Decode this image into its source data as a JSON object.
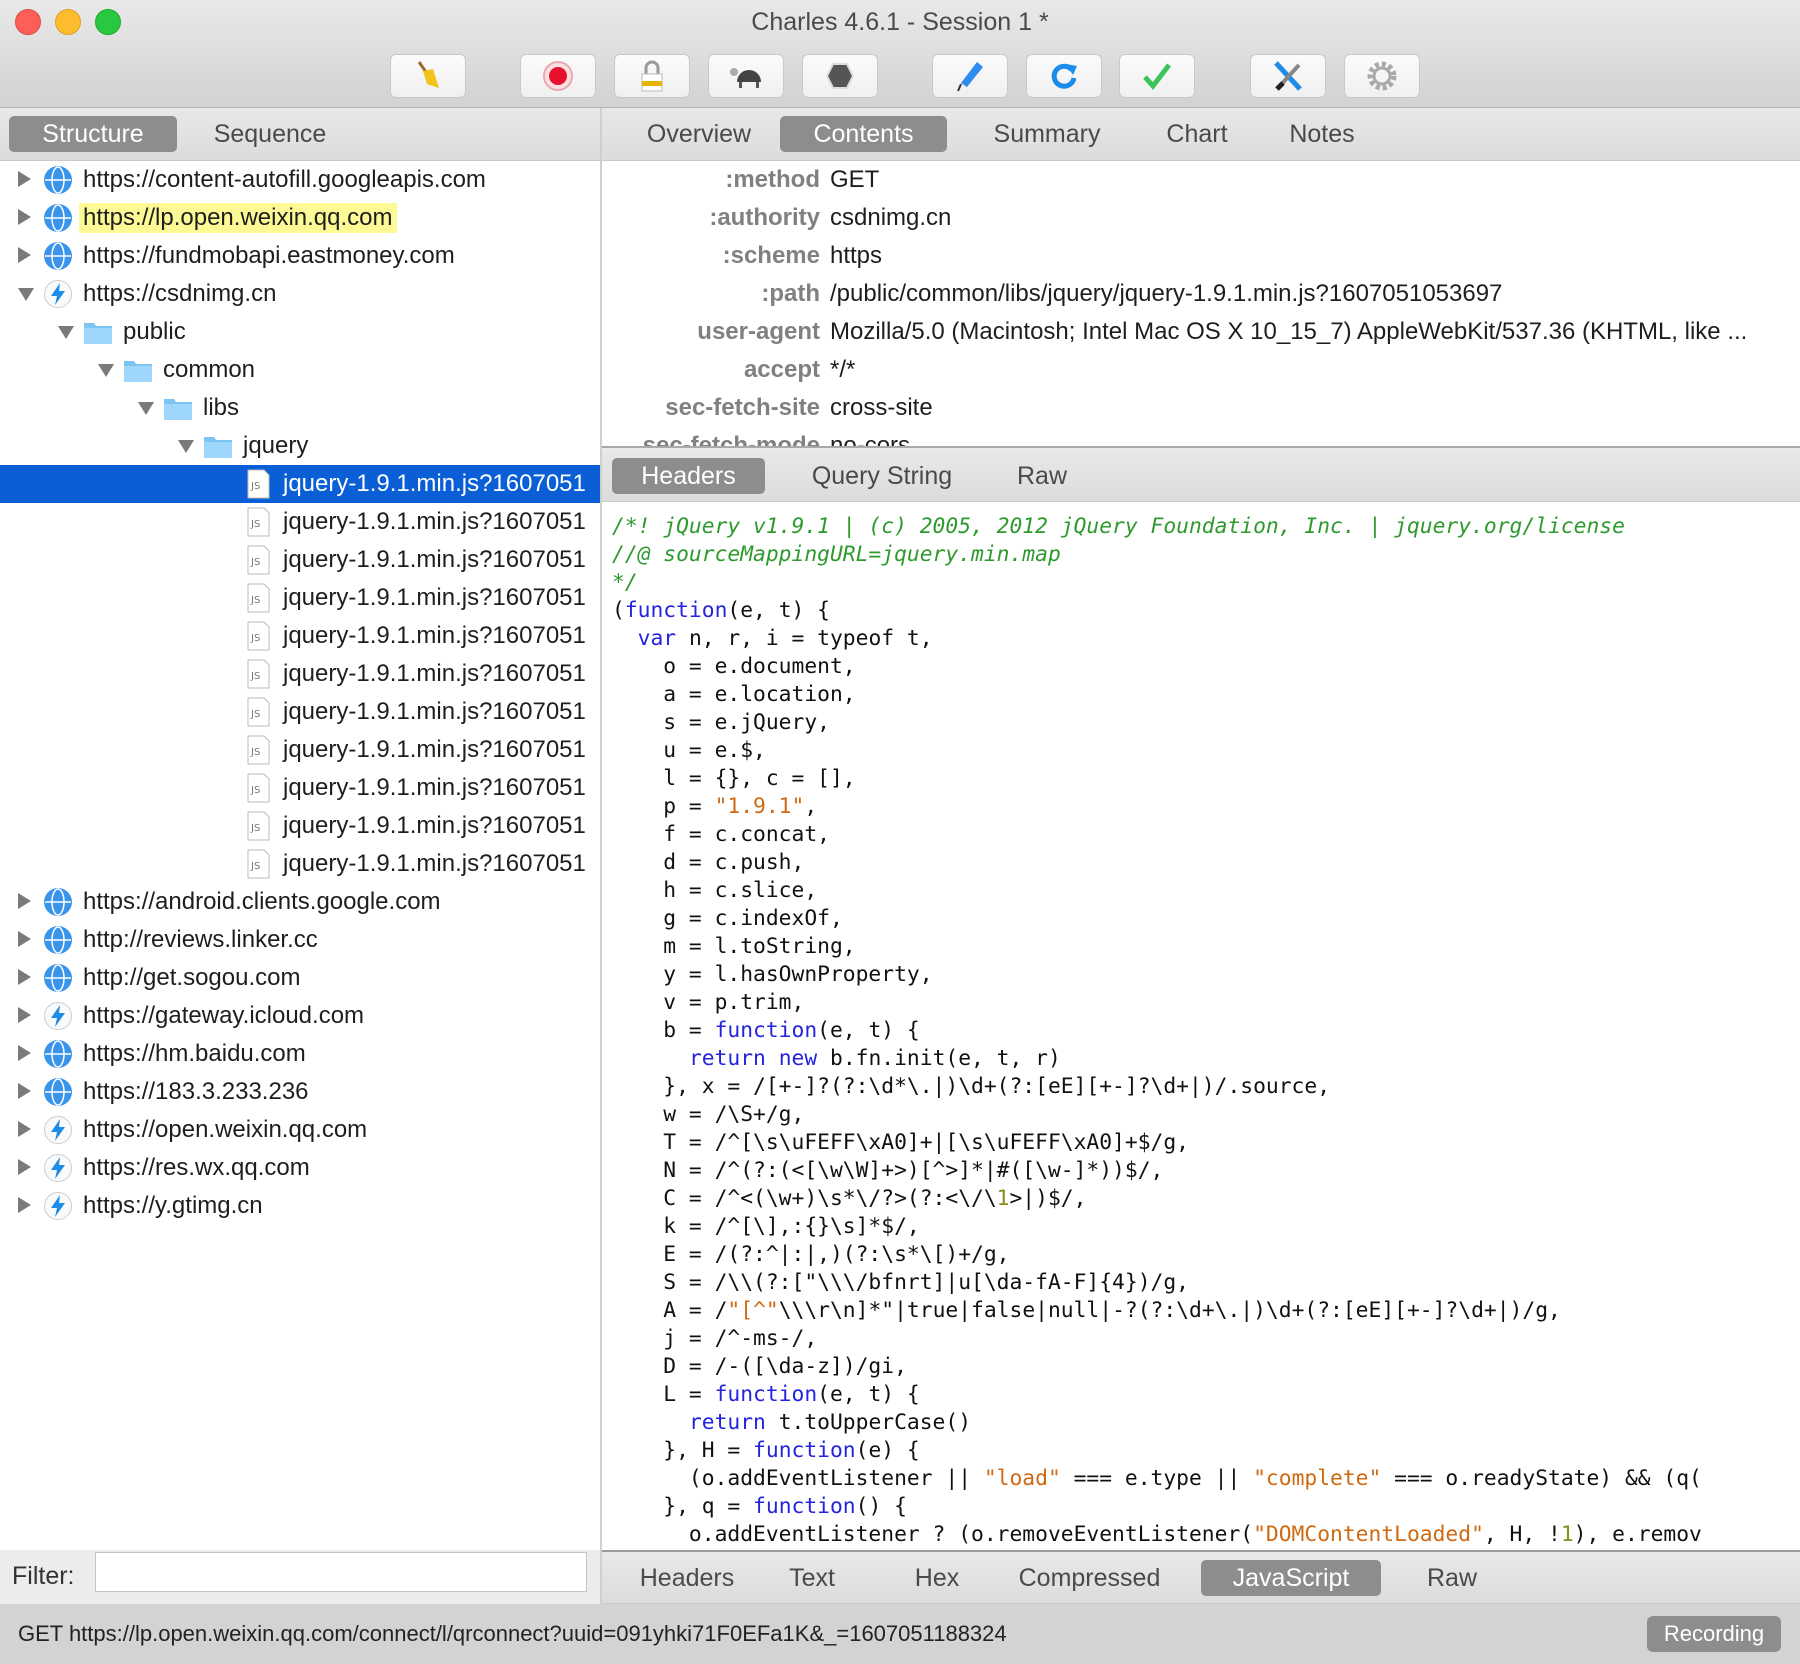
{
  "window": {
    "title": "Charles 4.6.1 - Session 1 *"
  },
  "toolbar": [
    {
      "icon": "broom-icon",
      "label": "Clear"
    },
    {
      "icon": "record-icon",
      "label": "Record"
    },
    {
      "icon": "ssl-lock-icon",
      "label": "SSL Proxying"
    },
    {
      "icon": "turtle-icon",
      "label": "Throttle"
    },
    {
      "icon": "breakpoint-hexagon-icon",
      "label": "Breakpoints"
    },
    {
      "icon": "compose-pen-icon",
      "label": "Compose"
    },
    {
      "icon": "repeat-icon",
      "label": "Repeat"
    },
    {
      "icon": "validate-check-icon",
      "label": "Validate"
    },
    {
      "icon": "tools-icon",
      "label": "Tools"
    },
    {
      "icon": "settings-gear-icon",
      "label": "Settings"
    }
  ],
  "left_tabs": [
    "Structure",
    "Sequence"
  ],
  "right_tabs": [
    "Overview",
    "Contents",
    "Summary",
    "Chart",
    "Notes"
  ],
  "tree": [
    {
      "level": 0,
      "icon": "globe",
      "exp": "c",
      "label": "https://content-autofill.googleapis.com"
    },
    {
      "level": 0,
      "icon": "globe",
      "exp": "c",
      "label": "https://lp.open.weixin.qq.com",
      "highlight": true
    },
    {
      "level": 0,
      "icon": "globe",
      "exp": "c",
      "label": "https://fundmobapi.eastmoney.com"
    },
    {
      "level": 0,
      "icon": "bolt",
      "exp": "o",
      "label": "https://csdnimg.cn"
    },
    {
      "level": 1,
      "icon": "folder",
      "exp": "o",
      "label": "public"
    },
    {
      "level": 2,
      "icon": "folder",
      "exp": "o",
      "label": "common"
    },
    {
      "level": 3,
      "icon": "folder",
      "exp": "o",
      "label": "libs"
    },
    {
      "level": 4,
      "icon": "folder",
      "exp": "o",
      "label": "jquery"
    },
    {
      "level": 5,
      "icon": "js",
      "label": "jquery-1.9.1.min.js?1607051",
      "selected": true
    },
    {
      "level": 5,
      "icon": "js",
      "label": "jquery-1.9.1.min.js?1607051"
    },
    {
      "level": 5,
      "icon": "js",
      "label": "jquery-1.9.1.min.js?1607051"
    },
    {
      "level": 5,
      "icon": "js",
      "label": "jquery-1.9.1.min.js?1607051"
    },
    {
      "level": 5,
      "icon": "js",
      "label": "jquery-1.9.1.min.js?1607051"
    },
    {
      "level": 5,
      "icon": "js",
      "label": "jquery-1.9.1.min.js?1607051"
    },
    {
      "level": 5,
      "icon": "js",
      "label": "jquery-1.9.1.min.js?1607051"
    },
    {
      "level": 5,
      "icon": "js",
      "label": "jquery-1.9.1.min.js?1607051"
    },
    {
      "level": 5,
      "icon": "js",
      "label": "jquery-1.9.1.min.js?1607051"
    },
    {
      "level": 5,
      "icon": "js",
      "label": "jquery-1.9.1.min.js?1607051"
    },
    {
      "level": 5,
      "icon": "js",
      "label": "jquery-1.9.1.min.js?1607051"
    },
    {
      "level": 0,
      "icon": "globe",
      "exp": "c",
      "label": "https://android.clients.google.com"
    },
    {
      "level": 0,
      "icon": "globe",
      "exp": "c",
      "label": "http://reviews.linker.cc"
    },
    {
      "level": 0,
      "icon": "globe",
      "exp": "c",
      "label": "http://get.sogou.com"
    },
    {
      "level": 0,
      "icon": "bolt",
      "exp": "c",
      "label": "https://gateway.icloud.com"
    },
    {
      "level": 0,
      "icon": "globe",
      "exp": "c",
      "label": "https://hm.baidu.com"
    },
    {
      "level": 0,
      "icon": "globe",
      "exp": "c",
      "label": "https://183.3.233.236"
    },
    {
      "level": 0,
      "icon": "bolt",
      "exp": "c",
      "label": "https://open.weixin.qq.com"
    },
    {
      "level": 0,
      "icon": "bolt",
      "exp": "c",
      "label": "https://res.wx.qq.com"
    },
    {
      "level": 0,
      "icon": "bolt",
      "exp": "c",
      "label": "https://y.gtimg.cn"
    }
  ],
  "headers": [
    {
      "k": ":method",
      "v": "GET"
    },
    {
      "k": ":authority",
      "v": "csdnimg.cn"
    },
    {
      "k": ":scheme",
      "v": "https"
    },
    {
      "k": ":path",
      "v": "/public/common/libs/jquery/jquery-1.9.1.min.js?1607051053697"
    },
    {
      "k": "user-agent",
      "v": "Mozilla/5.0 (Macintosh; Intel Mac OS X 10_15_7) AppleWebKit/537.36 (KHTML, like ..."
    },
    {
      "k": "accept",
      "v": "*/*"
    },
    {
      "k": "sec-fetch-site",
      "v": "cross-site"
    },
    {
      "k": "sec-fetch-mode",
      "v": "no-cors"
    }
  ],
  "request_tabs": [
    "Headers",
    "Query String",
    "Raw"
  ],
  "response_tabs": [
    "Headers",
    "Text",
    "Hex",
    "Compressed",
    "JavaScript",
    "Raw"
  ],
  "code": [
    [
      [
        "c",
        "/*! jQuery v1.9.1 | (c) 2005, 2012 jQuery Foundation, Inc. | jquery.org/license"
      ]
    ],
    [
      [
        "c",
        "//@ sourceMappingURL=jquery.min.map"
      ]
    ],
    [
      [
        "c",
        "*/"
      ]
    ],
    [
      [
        "p",
        "("
      ],
      [
        "k",
        "function"
      ],
      [
        "p",
        "(e, t) {"
      ]
    ],
    [
      [
        "p",
        "  "
      ],
      [
        "k",
        "var"
      ],
      [
        "p",
        " n, r, i = typeof t,"
      ]
    ],
    [
      [
        "p",
        "    o = e.document,"
      ]
    ],
    [
      [
        "p",
        "    a = e.location,"
      ]
    ],
    [
      [
        "p",
        "    s = e.jQuery,"
      ]
    ],
    [
      [
        "p",
        "    u = e.$,"
      ]
    ],
    [
      [
        "p",
        "    l = {}, c = [],"
      ]
    ],
    [
      [
        "p",
        "    p = "
      ],
      [
        "s",
        "\"1.9.1\""
      ],
      [
        "p",
        ","
      ]
    ],
    [
      [
        "p",
        "    f = c.concat,"
      ]
    ],
    [
      [
        "p",
        "    d = c.push,"
      ]
    ],
    [
      [
        "p",
        "    h = c.slice,"
      ]
    ],
    [
      [
        "p",
        "    g = c.indexOf,"
      ]
    ],
    [
      [
        "p",
        "    m = l.toString,"
      ]
    ],
    [
      [
        "p",
        "    y = l.hasOwnProperty,"
      ]
    ],
    [
      [
        "p",
        "    v = p.trim,"
      ]
    ],
    [
      [
        "p",
        "    b = "
      ],
      [
        "k",
        "function"
      ],
      [
        "p",
        "(e, t) {"
      ]
    ],
    [
      [
        "p",
        "      "
      ],
      [
        "k",
        "return"
      ],
      [
        "p",
        " "
      ],
      [
        "k",
        "new"
      ],
      [
        "p",
        " b.fn.init(e, t, r)"
      ]
    ],
    [
      [
        "p",
        "    }, x = /[+-]?(?:\\d*\\.|)\\d+(?:[eE][+-]?\\d+|)/.source,"
      ]
    ],
    [
      [
        "p",
        "    w = /\\S+/g,"
      ]
    ],
    [
      [
        "p",
        "    T = /^[\\s\\uFEFF\\xA0]+|[\\s\\uFEFF\\xA0]+$/g,"
      ]
    ],
    [
      [
        "p",
        "    N = /^(?:(<[\\w\\W]+>)[^>]*|#([\\w-]*))$/,"
      ]
    ],
    [
      [
        "p",
        "    C = /^<(\\w+)\\s*\\/?>(?:<\\/\\"
      ],
      [
        "n",
        "1"
      ],
      [
        "p",
        ">|)$/,"
      ]
    ],
    [
      [
        "p",
        "    k = /^[\\],:{}\\s]*$/,"
      ]
    ],
    [
      [
        "p",
        "    E = /(?:^|:|,)(?:\\s*\\[)+/g,"
      ]
    ],
    [
      [
        "p",
        "    S = /\\\\(?:[\"\\\\\\/bfnrt]|u[\\da-fA-F]{4})/g,"
      ]
    ],
    [
      [
        "p",
        "    A = /"
      ],
      [
        "s",
        "\"[^\""
      ],
      [
        "p",
        "\\\\\\r\\n]*\"|true|false|null|-?(?:\\d+\\.|)\\d+(?:[eE][+-]?\\d+|)/g,"
      ]
    ],
    [
      [
        "p",
        "    j = /^-ms-/,"
      ]
    ],
    [
      [
        "p",
        "    D = /-([\\da-z])/gi,"
      ]
    ],
    [
      [
        "p",
        "    L = "
      ],
      [
        "k",
        "function"
      ],
      [
        "p",
        "(e, t) {"
      ]
    ],
    [
      [
        "p",
        "      "
      ],
      [
        "k",
        "return"
      ],
      [
        "p",
        " t.toUpperCase()"
      ]
    ],
    [
      [
        "p",
        "    }, H = "
      ],
      [
        "k",
        "function"
      ],
      [
        "p",
        "(e) {"
      ]
    ],
    [
      [
        "p",
        "      (o.addEventListener || "
      ],
      [
        "s",
        "\"load\""
      ],
      [
        "p",
        " === e.type || "
      ],
      [
        "s",
        "\"complete\""
      ],
      [
        "p",
        " === o.readyState) && (q("
      ]
    ],
    [
      [
        "p",
        "    }, q = "
      ],
      [
        "k",
        "function"
      ],
      [
        "p",
        "() {"
      ]
    ],
    [
      [
        "p",
        "      o.addEventListener ? (o.removeEventListener("
      ],
      [
        "s",
        "\"DOMContentLoaded\""
      ],
      [
        "p",
        ", H, !"
      ],
      [
        "n",
        "1"
      ],
      [
        "p",
        "), e.remov"
      ]
    ]
  ],
  "filter": {
    "label": "Filter:",
    "value": ""
  },
  "status": {
    "text": "GET https://lp.open.weixin.qq.com/connect/l/qrconnect?uuid=091yhki71F0EFa1K&_=1607051188324",
    "recording": "Recording"
  },
  "colors": {
    "selection": "#0a5fd6",
    "highlight": "#fdfa96",
    "pill": "#8d8d8d",
    "comment": "#2e9a2e",
    "keyword": "#2323e0",
    "string": "#cf6a12"
  }
}
